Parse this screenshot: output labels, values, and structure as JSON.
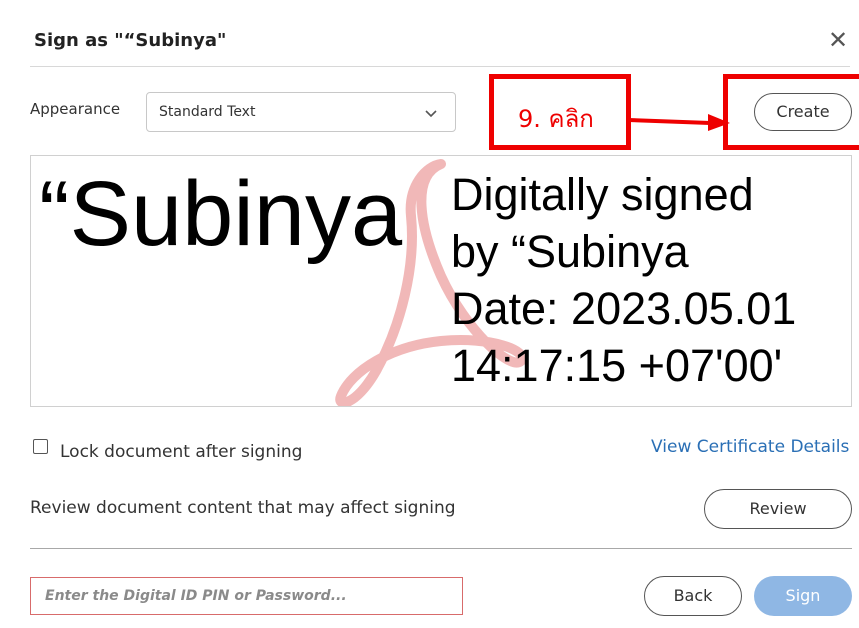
{
  "dialog": {
    "title": "Sign as \"“Subinya\"",
    "close_icon": "close-icon"
  },
  "appearance": {
    "label": "Appearance",
    "selected": "Standard Text",
    "chevron_icon": "chevron-down-icon"
  },
  "annotation": {
    "callout_text": "9. คลิก",
    "color": "#ee0000"
  },
  "buttons": {
    "create": "Create",
    "review": "Review",
    "back": "Back",
    "sign": "Sign"
  },
  "preview": {
    "name": "“Subinya",
    "details": [
      "Digitally signed",
      "by “Subinya",
      "Date: 2023.05.01",
      "14:17:15 +07'00'"
    ]
  },
  "options": {
    "lock_label": "Lock document after signing",
    "lock_checked": false,
    "certificate_link": "View Certificate Details",
    "review_text": "Review document content that may affect signing"
  },
  "pin": {
    "placeholder": "Enter the Digital ID PIN or Password...",
    "value": ""
  },
  "colors": {
    "accent_link": "#2a6fb5",
    "sign_button": "#8fb7e4",
    "annotation_red": "#ee0000",
    "input_error_border": "#d86b6b"
  }
}
